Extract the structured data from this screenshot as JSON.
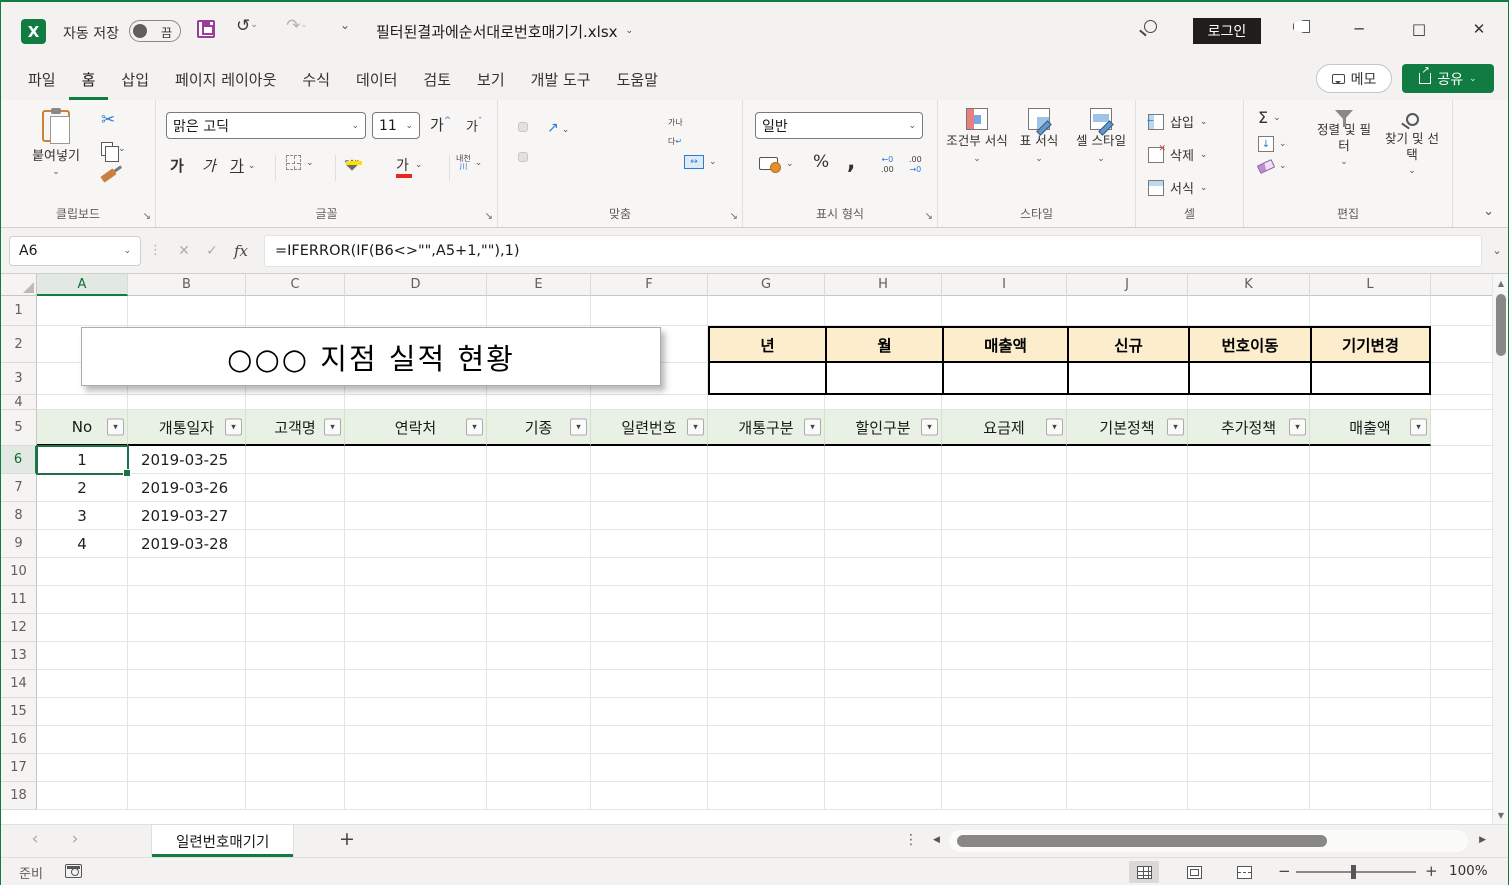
{
  "titlebar": {
    "app": "X",
    "autosave_label": "자동 저장",
    "autosave_state": "끔",
    "filename": "필터된결과에순서대로번호매기기.xlsx",
    "login": "로그인"
  },
  "tabs": {
    "items": [
      "파일",
      "홈",
      "삽입",
      "페이지 레이아웃",
      "수식",
      "데이터",
      "검토",
      "보기",
      "개발 도구",
      "도움말"
    ],
    "active": "홈",
    "memo": "메모",
    "share": "공유"
  },
  "ribbon": {
    "clipboard": {
      "label": "클립보드",
      "paste": "붙여넣기"
    },
    "font": {
      "label": "글꼴",
      "family": "맑은 고딕",
      "size": "11",
      "bold": "가",
      "italic": "가",
      "underline": "가",
      "color_glyph": "가",
      "phonetic_top": "내천",
      "phonetic_mark": "川"
    },
    "align": {
      "label": "맞춤",
      "wrap_line1": "가나",
      "wrap_line2": "다",
      "wrap_mark": "↵"
    },
    "number": {
      "label": "표시 형식",
      "format": "일반"
    },
    "styles": {
      "label": "스타일",
      "conditional": "조건부 서식",
      "table": "표 서식",
      "cellstyle": "셀 스타일"
    },
    "cells": {
      "label": "셀",
      "insert": "삽입",
      "delete": "삭제",
      "format": "서식"
    },
    "editing": {
      "label": "편집",
      "sort": "정렬 및 필터",
      "find": "찾기 및 선택"
    }
  },
  "formula_bar": {
    "name_box": "A6",
    "formula": "=IFERROR(IF(B6<>\"\",A5+1,\"\"),1)"
  },
  "sheet": {
    "columns": [
      "A",
      "B",
      "C",
      "D",
      "E",
      "F",
      "G",
      "H",
      "I",
      "J",
      "K",
      "L"
    ],
    "rows": [
      "1",
      "2",
      "3",
      "4",
      "5",
      "6",
      "7",
      "8",
      "9",
      "10",
      "11",
      "12",
      "13",
      "14",
      "15",
      "16",
      "17",
      "18"
    ],
    "selected_cell": "A6",
    "selected_col": "A",
    "selected_row": "6",
    "title_shape": "○○○ 지점  실적 현황",
    "summary_headers": [
      "년",
      "월",
      "매출액",
      "신규",
      "번호이동",
      "기기변경"
    ],
    "filter_headers": [
      "No",
      "개통일자",
      "고객명",
      "연락처",
      "기종",
      "일련번호",
      "개통구분",
      "할인구분",
      "요금제",
      "기본정책",
      "추가정책",
      "매출액"
    ],
    "cells": {
      "A6": "1",
      "A7": "2",
      "A8": "3",
      "A9": "4",
      "B6": "2019-03-25",
      "B7": "2019-03-26",
      "B8": "2019-03-27",
      "B9": "2019-03-28"
    }
  },
  "sheet_tabs": {
    "active": "일련번호매기기"
  },
  "status": {
    "mode": "준비",
    "zoom": "100%"
  },
  "colors": {
    "accent_green": "#107C41",
    "filter_row_green": "#E9F1E4",
    "summary_tan": "#FCEECD"
  }
}
